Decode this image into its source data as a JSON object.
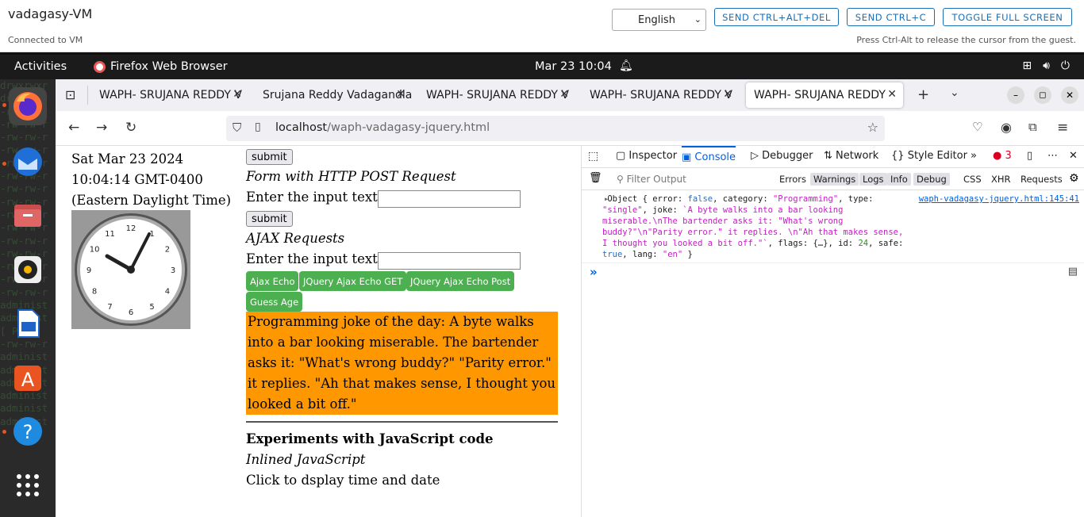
{
  "vm": {
    "title": "vadagasy-VM",
    "status": "Connected to VM",
    "language": "English",
    "buttons": [
      "SEND CTRL+ALT+DEL",
      "SEND CTRL+C",
      "TOGGLE FULL SCREEN"
    ],
    "hint": "Press Ctrl-Alt to release the cursor from the guest."
  },
  "topbar": {
    "activities": "Activities",
    "app": "Firefox Web Browser",
    "clock": "Mar 23  10:04"
  },
  "dock": {
    "background": "drwxrwxr\ndrwxrwxr\n-rw-rw-r\n-rw-rw-r\n-rw-rw-r\n-rw-rw-r\n-rw-rw-r\n-rw-rw-r\n-rw-rw-r\n-rw-rw-r\n-rw-rw-r\n-rw-rw-r\n-rw-rw-r\n-rw-rw-r\n-rw-rw-r\n-rw-rw-r\n-rw-rw-r\nadminist\nadminist\n[ P\n-rw-rw-r\nadminist\nadminist\nadminist\nadminist\nadminist\nadminist",
    "items": [
      "firefox-icon",
      "thunderbird-icon",
      "files-icon",
      "rhythmbox-icon",
      "writer-icon",
      "app-center-icon",
      "help-icon",
      "apps-grid-icon"
    ]
  },
  "tabs": [
    "WAPH- SRUJANA REDDY V",
    "Srujana Reddy Vadagandla",
    "WAPH- SRUJANA REDDY V",
    "WAPH- SRUJANA REDDY V",
    "WAPH- SRUJANA REDDY V"
  ],
  "url": {
    "host": "localhost",
    "path": "/waph-vadagasy-jquery.html"
  },
  "page": {
    "date": "Sat Mar 23 2024 10:04:14 GMT-0400 (Eastern Daylight Time)",
    "submit1": "submit",
    "post_heading": "Form with HTTP POST Request",
    "input_label1": "Enter the input text",
    "submit2": "submit",
    "ajax_heading": "AJAX Requests",
    "input_label2": "Enter the input text",
    "ajax_buttons": [
      "Ajax Echo",
      "JQuery Ajax Echo GET",
      "JQuery Ajax Echo Post",
      "Guess Age"
    ],
    "joke": "Programming joke of the day: A byte walks into a bar looking miserable. The bartender asks it: \"What's wrong buddy?\" \"Parity error.\" it replies. \"Ah that makes sense, I thought you looked a bit off.\"",
    "js_heading": "Experiments with JavaScript code",
    "inline_heading": "Inlined JavaScript",
    "click_text": "Click to dsplay time and date",
    "clock_numbers": [
      "12",
      "1",
      "2",
      "3",
      "4",
      "5",
      "6",
      "7",
      "8",
      "9",
      "10",
      "11"
    ]
  },
  "devtools": {
    "tabs": [
      "Inspector",
      "Console",
      "Debugger",
      "Network",
      "Style Editor"
    ],
    "error_count": "3",
    "filter_placeholder": "Filter Output",
    "levels": [
      "Errors",
      "Warnings",
      "Logs",
      "Info",
      "Debug"
    ],
    "types": [
      "CSS",
      "XHR",
      "Requests"
    ],
    "log_source": "waph-vadagasy-jquery.html:145:41",
    "log": {
      "error": "false",
      "category": "\"Programming\"",
      "type": "\"single\"",
      "joke": "`A byte walks into a bar looking miserable.\\nThe bartender asks it: \"What's wrong buddy?\"\\n\"Parity error.\" it replies. \\n\"Ah that makes sense, I thought you looked a bit off.\"`",
      "flags": "{…}",
      "id": "24",
      "safe": "true",
      "lang": "\"en\""
    }
  }
}
